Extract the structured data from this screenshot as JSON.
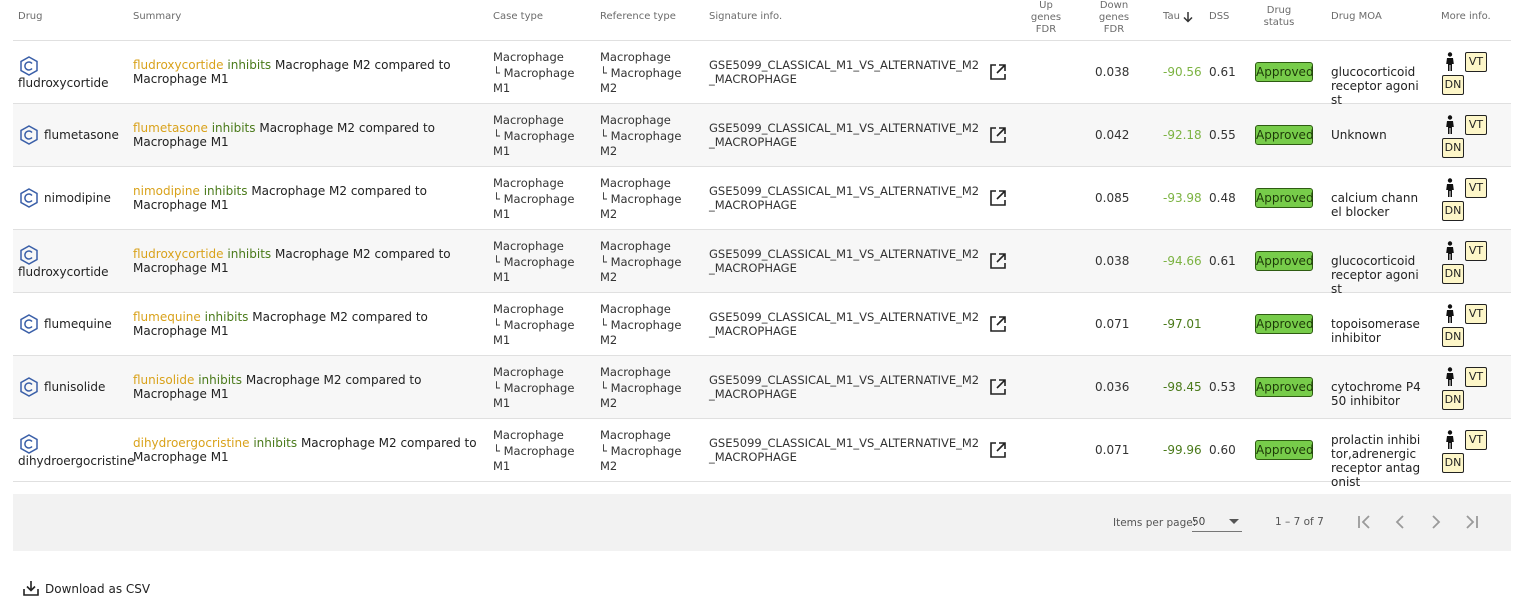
{
  "columns": {
    "drug": "Drug",
    "summary": "Summary",
    "case_type": "Case type",
    "reference_type": "Reference type",
    "signature_info": "Signature info.",
    "up_fdr": "Up genes FDR",
    "down_fdr": "Down genes FDR",
    "tau": "Tau",
    "dss": "DSS",
    "drug_status": "Drug status",
    "drug_moa": "Drug MOA",
    "more_info": "More info."
  },
  "colors": {
    "drug_text": "#d9a21b",
    "verb_text": "#4a7a1a",
    "approved_bg": "#77cc4a",
    "tag_bg": "#fdf6c8",
    "tau_light": "#7cb342",
    "tau_dark": "#4a7a1a"
  },
  "rows": [
    {
      "drug": "fludroxycortide",
      "name_layout": "below",
      "summary_drug": "fludroxycortide",
      "summary_verb": "inhibits",
      "summary_rest": "Macrophage M2 compared to Macrophage M1",
      "case_top": "Macrophage",
      "case_sub": "└ Macrophage",
      "case_last": "M1",
      "ref_top": "Macrophage",
      "ref_sub": "└ Macrophage",
      "ref_last": "M2",
      "signature": "GSE5099_CLASSICAL_M1_VS_ALTERNATIVE_M2_MACROPHAGE",
      "up_fdr": "",
      "down_fdr": "0.038",
      "tau": "-90.56",
      "tau_tone": "light",
      "dss": "0.61",
      "status": "Approved",
      "moa": "glucocorticoid receptor agonist",
      "tag_vt": "VT",
      "tag_dn": "DN"
    },
    {
      "drug": "flumetasone",
      "name_layout": "beside",
      "summary_drug": "flumetasone",
      "summary_verb": "inhibits",
      "summary_rest": "Macrophage M2 compared to Macrophage M1",
      "case_top": "Macrophage",
      "case_sub": "└ Macrophage",
      "case_last": "M1",
      "ref_top": "Macrophage",
      "ref_sub": "└ Macrophage",
      "ref_last": "M2",
      "signature": "GSE5099_CLASSICAL_M1_VS_ALTERNATIVE_M2_MACROPHAGE",
      "up_fdr": "",
      "down_fdr": "0.042",
      "tau": "-92.18",
      "tau_tone": "light",
      "dss": "0.55",
      "status": "Approved",
      "moa": "Unknown",
      "tag_vt": "VT",
      "tag_dn": "DN"
    },
    {
      "drug": "nimodipine",
      "name_layout": "beside",
      "summary_drug": "nimodipine",
      "summary_verb": "inhibits",
      "summary_rest": "Macrophage M2 compared to Macrophage M1",
      "case_top": "Macrophage",
      "case_sub": "└ Macrophage",
      "case_last": "M1",
      "ref_top": "Macrophage",
      "ref_sub": "└ Macrophage",
      "ref_last": "M2",
      "signature": "GSE5099_CLASSICAL_M1_VS_ALTERNATIVE_M2_MACROPHAGE",
      "up_fdr": "",
      "down_fdr": "0.085",
      "tau": "-93.98",
      "tau_tone": "light",
      "dss": "0.48",
      "status": "Approved",
      "moa": "calcium channel blocker",
      "tag_vt": "VT",
      "tag_dn": "DN"
    },
    {
      "drug": "fludroxycortide",
      "name_layout": "below",
      "summary_drug": "fludroxycortide",
      "summary_verb": "inhibits",
      "summary_rest": "Macrophage M2 compared to Macrophage M1",
      "case_top": "Macrophage",
      "case_sub": "└ Macrophage",
      "case_last": "M1",
      "ref_top": "Macrophage",
      "ref_sub": "└ Macrophage",
      "ref_last": "M2",
      "signature": "GSE5099_CLASSICAL_M1_VS_ALTERNATIVE_M2_MACROPHAGE",
      "up_fdr": "",
      "down_fdr": "0.038",
      "tau": "-94.66",
      "tau_tone": "light",
      "dss": "0.61",
      "status": "Approved",
      "moa": "glucocorticoid receptor agonist",
      "tag_vt": "VT",
      "tag_dn": "DN"
    },
    {
      "drug": "flumequine",
      "name_layout": "beside",
      "summary_drug": "flumequine",
      "summary_verb": "inhibits",
      "summary_rest": "Macrophage M2 compared to Macrophage M1",
      "case_top": "Macrophage",
      "case_sub": "└ Macrophage",
      "case_last": "M1",
      "ref_top": "Macrophage",
      "ref_sub": "└ Macrophage",
      "ref_last": "M2",
      "signature": "GSE5099_CLASSICAL_M1_VS_ALTERNATIVE_M2_MACROPHAGE",
      "up_fdr": "",
      "down_fdr": "0.071",
      "tau": "-97.01",
      "tau_tone": "dark",
      "dss": "",
      "status": "Approved",
      "moa": "topoisomerase inhibitor",
      "tag_vt": "VT",
      "tag_dn": "DN"
    },
    {
      "drug": "flunisolide",
      "name_layout": "beside",
      "summary_drug": "flunisolide",
      "summary_verb": "inhibits",
      "summary_rest": "Macrophage M2 compared to Macrophage M1",
      "case_top": "Macrophage",
      "case_sub": "└ Macrophage",
      "case_last": "M1",
      "ref_top": "Macrophage",
      "ref_sub": "└ Macrophage",
      "ref_last": "M2",
      "signature": "GSE5099_CLASSICAL_M1_VS_ALTERNATIVE_M2_MACROPHAGE",
      "up_fdr": "",
      "down_fdr": "0.036",
      "tau": "-98.45",
      "tau_tone": "dark",
      "dss": "0.53",
      "status": "Approved",
      "moa": "cytochrome P450 inhibitor",
      "tag_vt": "VT",
      "tag_dn": "DN"
    },
    {
      "drug": "dihydroergocristine",
      "name_layout": "below",
      "summary_drug": "dihydroergocristine",
      "summary_verb": "inhibits",
      "summary_rest": "Macrophage M2 compared to Macrophage M1",
      "case_top": "Macrophage",
      "case_sub": "└ Macrophage",
      "case_last": "M1",
      "ref_top": "Macrophage",
      "ref_sub": "└ Macrophage",
      "ref_last": "M2",
      "signature": "GSE5099_CLASSICAL_M1_VS_ALTERNATIVE_M2_MACROPHAGE",
      "up_fdr": "",
      "down_fdr": "0.071",
      "tau": "-99.96",
      "tau_tone": "dark",
      "dss": "0.60",
      "status": "Approved",
      "moa": "prolactin inhibitor,adrenergic receptor antagonist",
      "tag_vt": "VT",
      "tag_dn": "DN"
    }
  ],
  "paginator": {
    "items_per_page_label": "Items per page:",
    "items_per_page_value": "50",
    "range_label": "1 – 7 of 7"
  },
  "download": {
    "label": "Download as CSV"
  },
  "icons": {
    "drug": "hexagon-molecule-icon",
    "external": "open-in-new-icon",
    "person": "human-body-icon",
    "sort": "arrow-down-icon",
    "download": "download-icon",
    "first": "first-page-icon",
    "prev": "chevron-left-icon",
    "next": "chevron-right-icon",
    "last": "last-page-icon"
  }
}
